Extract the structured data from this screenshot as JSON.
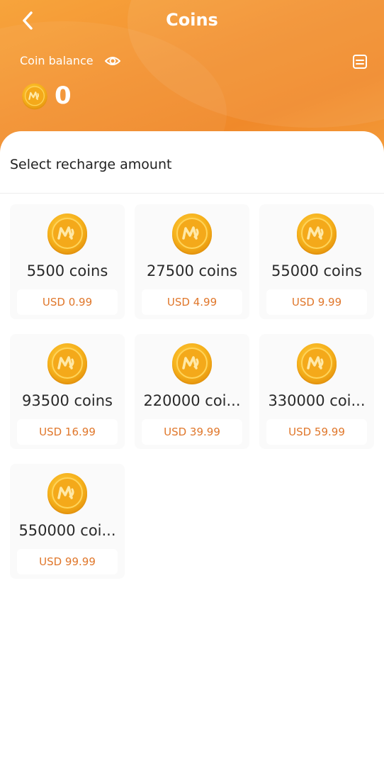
{
  "header": {
    "title": "Coins",
    "balance_label": "Coin balance",
    "balance_value": "0"
  },
  "section_title": "Select recharge amount",
  "packages": [
    {
      "amount": "5500 coins",
      "price": "USD 0.99"
    },
    {
      "amount": "27500 coins",
      "price": "USD 4.99"
    },
    {
      "amount": "55000 coins",
      "price": "USD 9.99"
    },
    {
      "amount": "93500 coins",
      "price": "USD 16.99"
    },
    {
      "amount": "220000 coi...",
      "price": "USD 39.99"
    },
    {
      "amount": "330000 coi...",
      "price": "USD 59.99"
    },
    {
      "amount": "550000 coi...",
      "price": "USD 99.99"
    }
  ],
  "colors": {
    "header_orange": "#f39231",
    "price_text": "#e0772b",
    "coin_gold": "#f6b21c"
  },
  "icons": {
    "back": "chevron-left-icon",
    "eye": "eye-icon",
    "record": "record-icon",
    "coin": "coin-icon"
  }
}
